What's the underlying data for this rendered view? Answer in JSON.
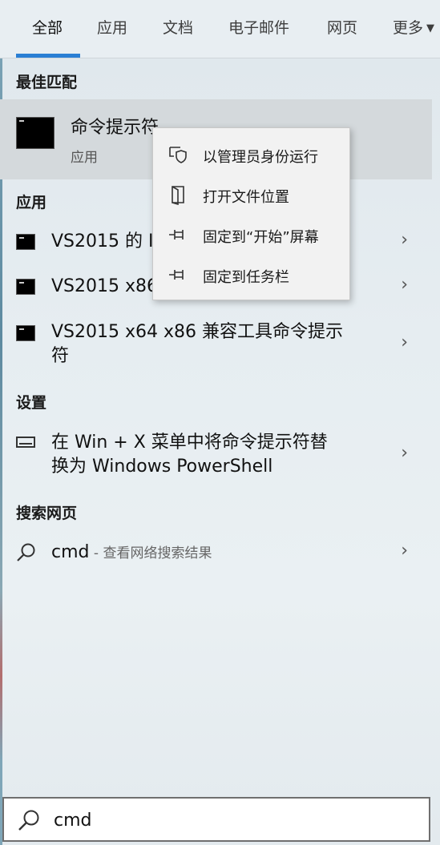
{
  "tabs": [
    {
      "label": "全部"
    },
    {
      "label": "应用"
    },
    {
      "label": "文档"
    },
    {
      "label": "电子邮件"
    },
    {
      "label": "网页"
    },
    {
      "label": "更多"
    }
  ],
  "sections": {
    "best_match": "最佳匹配",
    "apps": "应用",
    "settings": "设置",
    "web": "搜索网页"
  },
  "best_match": {
    "title": "命令提示符",
    "subtitle": "应用"
  },
  "apps": [
    {
      "label": "VS2015 的 I"
    },
    {
      "label": "VS2015 x86"
    },
    {
      "label": "VS2015 x64 x86 兼容工具命令提示",
      "label_line2": "符"
    }
  ],
  "settings_item": {
    "line1": "在 Win + X 菜单中将命令提示符替",
    "line2": "换为 Windows PowerShell"
  },
  "web_item": {
    "query": "cmd",
    "desc": " - 查看网络搜索结果"
  },
  "context_menu": [
    {
      "label": "以管理员身份运行",
      "icon": "shield-icon"
    },
    {
      "label": "打开文件位置",
      "icon": "folder-icon"
    },
    {
      "label": "固定到“开始”屏幕",
      "icon": "pin-icon"
    },
    {
      "label": "固定到任务栏",
      "icon": "pin-icon"
    }
  ],
  "search": {
    "value": "cmd"
  },
  "colors": {
    "accent": "#2a7fd4",
    "selected_bg": "#d4d9dc"
  }
}
